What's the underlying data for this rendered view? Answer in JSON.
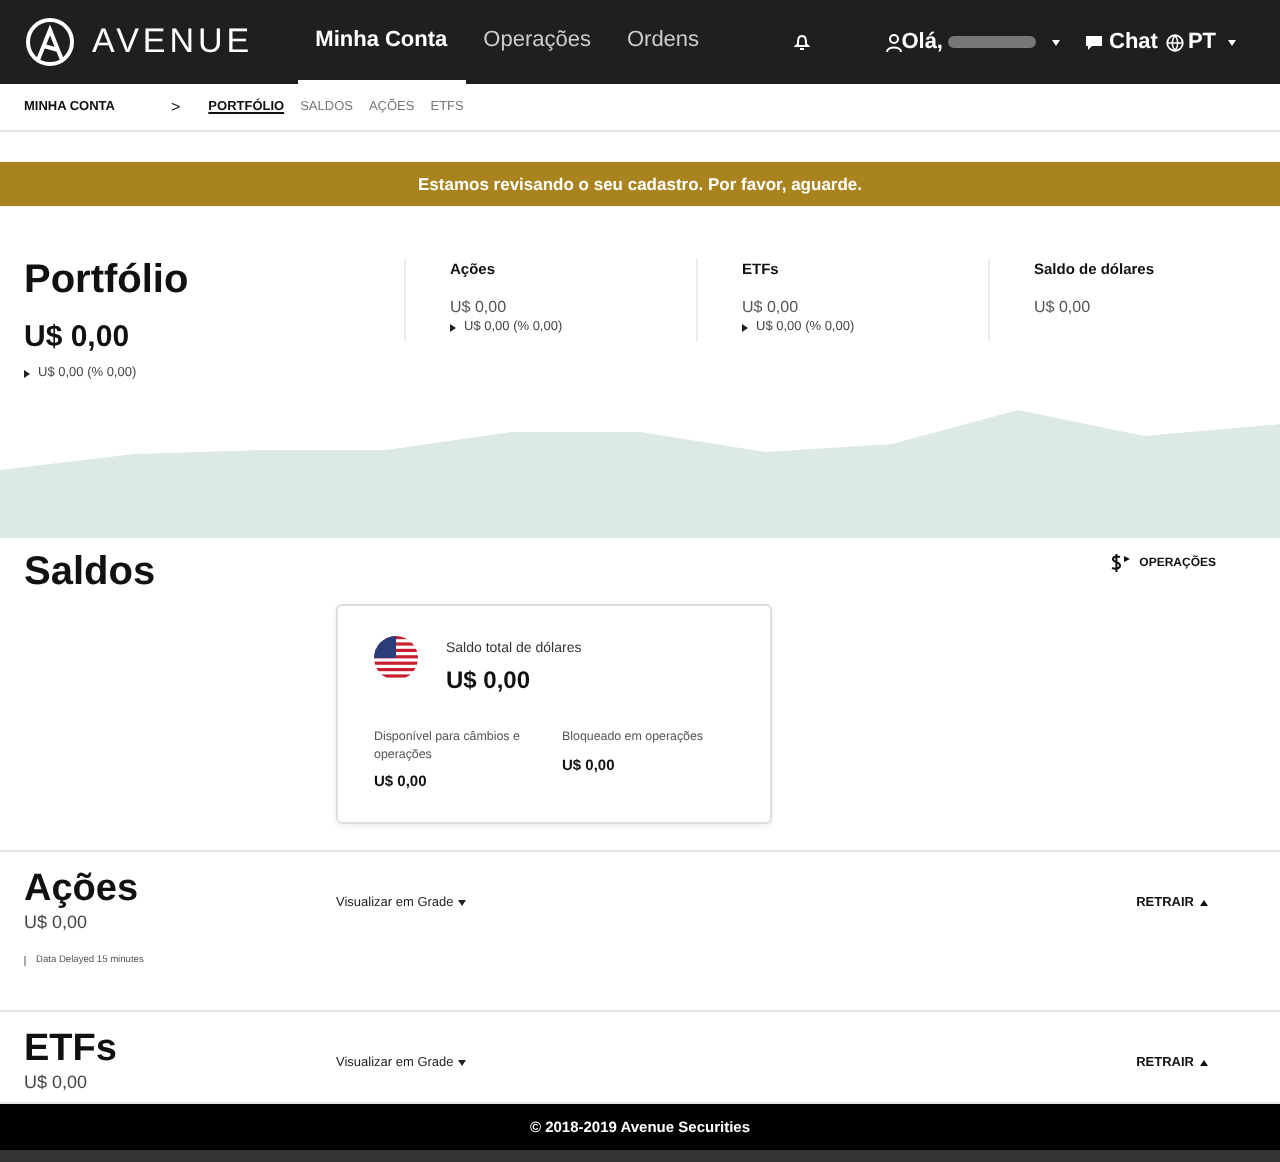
{
  "header": {
    "brand": "AVENUE",
    "nav": [
      {
        "label": "Minha Conta",
        "selected": true
      },
      {
        "label": "Operações",
        "selected": false
      },
      {
        "label": "Ordens",
        "selected": false
      }
    ],
    "greeting": "Olá,",
    "chat": "Chat",
    "language": "PT"
  },
  "breadcrumb": {
    "root": "MINHA CONTA",
    "separator": ">",
    "links": [
      {
        "label": "PORTFÓLIO",
        "selected": true
      },
      {
        "label": "SALDOS",
        "selected": false
      },
      {
        "label": "AÇÕES",
        "selected": false
      },
      {
        "label": "ETFS",
        "selected": false
      }
    ]
  },
  "banner": "Estamos revisando o seu cadastro. Por favor, aguarde.",
  "portfolio": {
    "title": "Portfólio",
    "value": "U$ 0,00",
    "change": "U$ 0,00 (% 0,00)",
    "stats": [
      {
        "label": "Ações",
        "value": "U$ 0,00",
        "change": "U$ 0,00 (% 0,00)"
      },
      {
        "label": "ETFs",
        "value": "U$ 0,00",
        "change": "U$ 0,00 (% 0,00)"
      },
      {
        "label": "Saldo de dólares",
        "value": "U$ 0,00"
      }
    ]
  },
  "saldos": {
    "title": "Saldos",
    "action": "OPERAÇÕES",
    "card": {
      "label": "Saldo total de dólares",
      "value": "U$ 0,00",
      "details": [
        {
          "label": "Disponível para câmbios e operações",
          "value": "U$ 0,00"
        },
        {
          "label": "Bloqueado em operações",
          "value": "U$ 0,00"
        }
      ]
    }
  },
  "sections": [
    {
      "title": "Ações",
      "value": "U$ 0,00",
      "view": "Visualizar em Grade",
      "toggle": "RETRAIR",
      "note": "Data Delayed 15 minutes"
    },
    {
      "title": "ETFs",
      "value": "U$ 0,00",
      "view": "Visualizar em Grade",
      "toggle": "RETRAIR"
    }
  ],
  "footer": "© 2018-2019 Avenue Securities"
}
